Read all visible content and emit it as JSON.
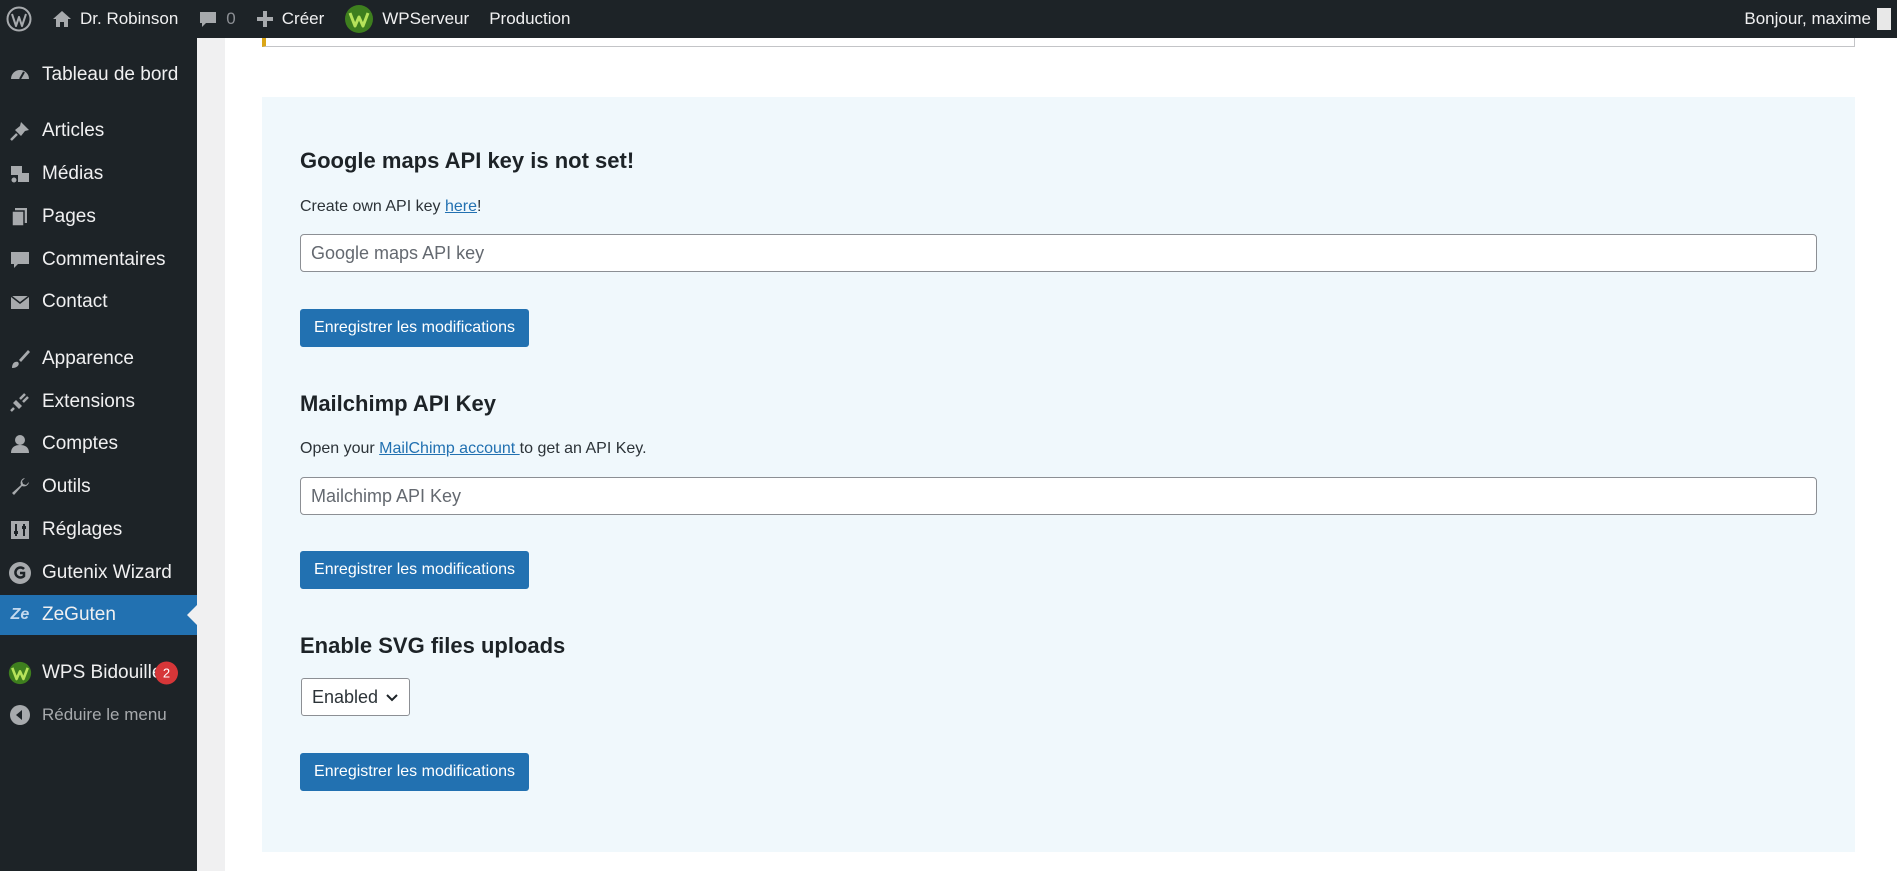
{
  "admin_bar": {
    "site_name": "Dr. Robinson",
    "comments_count": "0",
    "new_label": "Créer",
    "wpserveur_label": "WPServeur",
    "production_label": "Production",
    "greeting": "Bonjour, maxime"
  },
  "sidebar": {
    "items": [
      {
        "label": "Tableau de bord",
        "icon": "dashboard-icon"
      },
      {
        "label": "Articles",
        "icon": "pushpin-icon"
      },
      {
        "label": "Médias",
        "icon": "media-icon"
      },
      {
        "label": "Pages",
        "icon": "pages-icon"
      },
      {
        "label": "Commentaires",
        "icon": "comment-icon"
      },
      {
        "label": "Contact",
        "icon": "mail-icon"
      },
      {
        "label": "Apparence",
        "icon": "brush-icon"
      },
      {
        "label": "Extensions",
        "icon": "plugin-icon"
      },
      {
        "label": "Comptes",
        "icon": "user-icon"
      },
      {
        "label": "Outils",
        "icon": "wrench-icon"
      },
      {
        "label": "Réglages",
        "icon": "settings-icon"
      },
      {
        "label": "Gutenix Wizard",
        "icon": "gutenix-icon"
      },
      {
        "label": "ZeGuten",
        "icon": "zeguten-icon",
        "icon_text": "Ze"
      },
      {
        "label": "WPS Bidouille",
        "icon": "wps-icon",
        "badge": "2"
      },
      {
        "label": "Réduire le menu",
        "icon": "collapse-icon"
      }
    ],
    "current_item": "ZeGuten"
  },
  "main": {
    "google_maps": {
      "title": "Google maps API key is not set!",
      "desc_prefix": "Create own API key ",
      "desc_link": "here",
      "desc_suffix": "!",
      "input_placeholder": "Google maps API key",
      "input_value": "",
      "save_label": "Enregistrer les modifications"
    },
    "mailchimp": {
      "title": "Mailchimp API Key",
      "desc_prefix": "Open your ",
      "desc_link": "MailChimp account ",
      "desc_suffix": "to get an API Key.",
      "input_placeholder": "Mailchimp API Key",
      "input_value": "",
      "save_label": "Enregistrer les modifications"
    },
    "svg_uploads": {
      "title": "Enable SVG files uploads",
      "selected_option": "Enabled",
      "save_label": "Enregistrer les modifications"
    }
  },
  "colors": {
    "admin_dark": "#1d2327",
    "accent_blue": "#2271b1",
    "panel_bg": "#f0f8fc",
    "badge_red": "#d63638",
    "wps_green": "#3e7f1e",
    "notice_yellow": "#dba617"
  }
}
